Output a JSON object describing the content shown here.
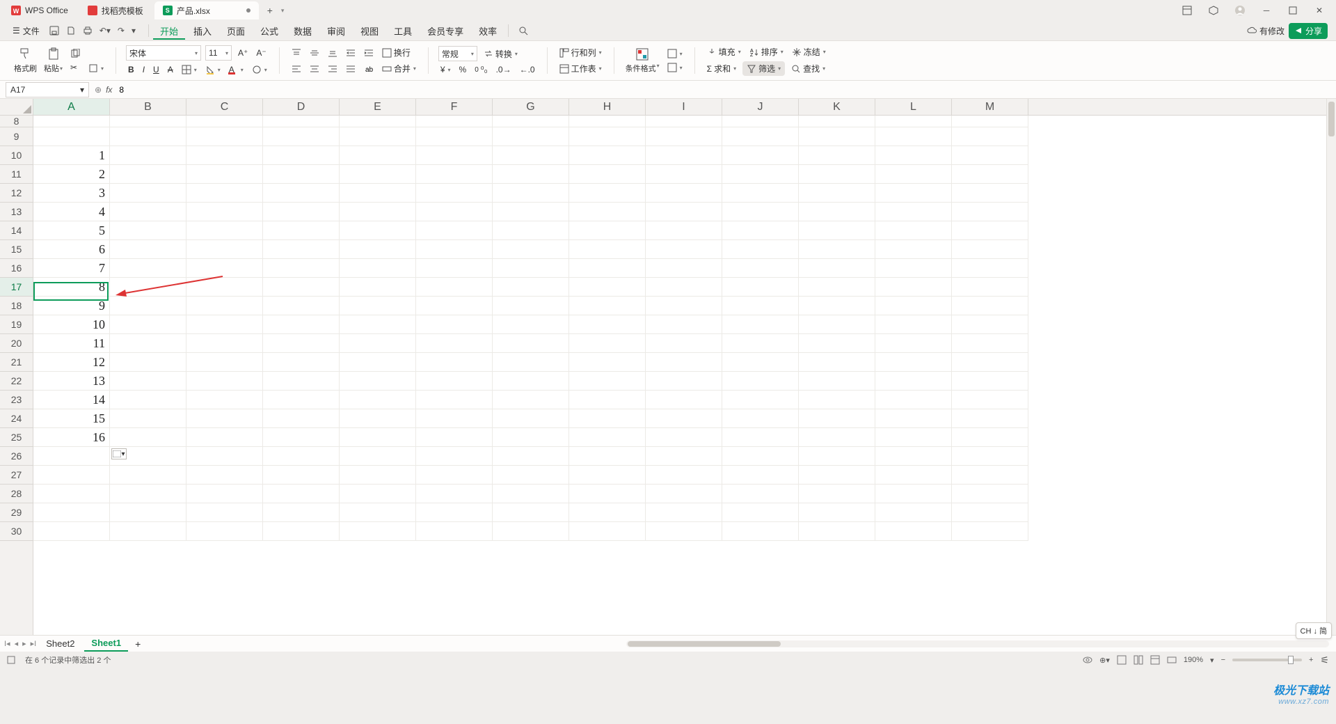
{
  "titlebar": {
    "app_label": "WPS Office",
    "template_label": "找稻壳模板",
    "filename": "产品.xlsx",
    "add_tab": "+"
  },
  "menubar": {
    "file": "文件",
    "items": [
      "开始",
      "插入",
      "页面",
      "公式",
      "数据",
      "审阅",
      "视图",
      "工具",
      "会员专享",
      "效率"
    ],
    "pending_changes": "有修改",
    "share": "分享"
  },
  "ribbon": {
    "format_painter": "格式刷",
    "paste": "粘贴",
    "font_name": "宋体",
    "font_size": "11",
    "wrap": "换行",
    "merge": "合并",
    "number_format": "常规",
    "convert": "转换",
    "row_col": "行和列",
    "worksheet": "工作表",
    "cond_format": "条件格式",
    "fill": "填充",
    "sort": "排序",
    "freeze": "冻结",
    "sum": "求和",
    "filter": "筛选",
    "find": "查找"
  },
  "namebox": {
    "cell_ref": "A17",
    "formula_value": "8"
  },
  "columns": [
    "A",
    "B",
    "C",
    "D",
    "E",
    "F",
    "G",
    "H",
    "I",
    "J",
    "K",
    "L",
    "M"
  ],
  "rows": [
    "8",
    "9",
    "10",
    "11",
    "12",
    "13",
    "14",
    "15",
    "16",
    "17",
    "18",
    "19",
    "20",
    "21",
    "22",
    "23",
    "24",
    "25",
    "26",
    "27",
    "28",
    "29",
    "30"
  ],
  "cell_values": {
    "10": "1",
    "11": "2",
    "12": "3",
    "13": "4",
    "14": "5",
    "15": "6",
    "16": "7",
    "17": "8",
    "18": "9",
    "19": "10",
    "20": "11",
    "21": "12",
    "22": "13",
    "23": "14",
    "24": "15",
    "25": "16"
  },
  "sheets": {
    "sheet2": "Sheet2",
    "sheet1": "Sheet1"
  },
  "statusbar": {
    "filter_summary": "在 6 个记录中筛选出 2 个",
    "zoom": "190%"
  },
  "ime": "CH ↓ 简",
  "watermark": {
    "l1": "极光下载站",
    "l2": "www.xz7.com"
  }
}
